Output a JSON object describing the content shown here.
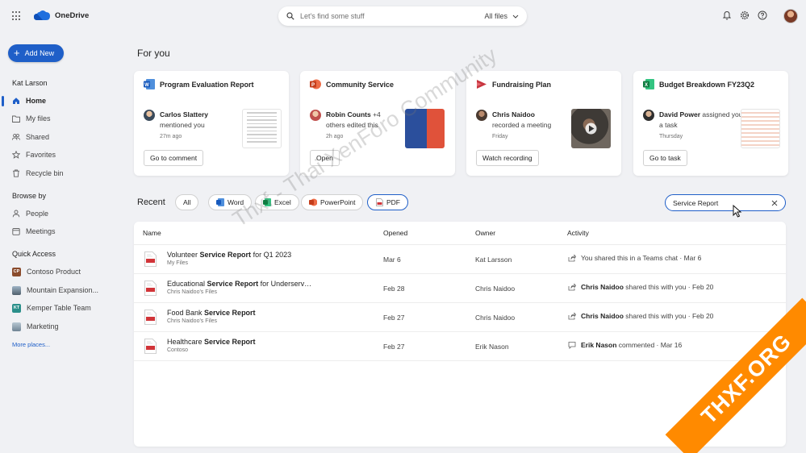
{
  "app": {
    "name": "OneDrive"
  },
  "search": {
    "placeholder": "Let's find some stuff",
    "scope": "All files"
  },
  "sidebar": {
    "add_new": "Add New",
    "user": "Kat Larson",
    "nav": [
      {
        "label": "Home",
        "icon": "home-icon"
      },
      {
        "label": "My files",
        "icon": "folder-icon"
      },
      {
        "label": "Shared",
        "icon": "people-icon"
      },
      {
        "label": "Favorites",
        "icon": "star-icon"
      },
      {
        "label": "Recycle bin",
        "icon": "trash-icon"
      }
    ],
    "browse_by": "Browse by",
    "browse": [
      {
        "label": "People",
        "icon": "person-icon"
      },
      {
        "label": "Meetings",
        "icon": "calendar-icon"
      }
    ],
    "quick_access": "Quick Access",
    "quick": [
      {
        "label": "Contoso Product",
        "badge": "CP",
        "color": "#8a4b2c"
      },
      {
        "label": "Mountain Expansion...",
        "badge": "",
        "color": "#6b7d8f"
      },
      {
        "label": "Kemper Table Team",
        "badge": "KT",
        "color": "#2a8f8a"
      },
      {
        "label": "Marketing",
        "badge": "",
        "color": "#8fa3b3"
      }
    ],
    "more_places": "More places..."
  },
  "for_you": {
    "heading": "For you",
    "cards": [
      {
        "title": "Program Evaluation Report",
        "app": "word",
        "person": "Carlos Slattery",
        "action": "mentioned you",
        "time": "27m ago",
        "button": "Go to comment"
      },
      {
        "title": "Community Service",
        "app": "powerpoint",
        "person": "Robin Counts",
        "extra": "+4",
        "action": "others edited this",
        "time": "2h ago",
        "button": "Open"
      },
      {
        "title": "Fundraising Plan",
        "app": "stream",
        "person": "Chris Naidoo",
        "action": "recorded a meeting",
        "time": "Friday",
        "button": "Watch recording"
      },
      {
        "title": "Budget Breakdown FY23Q2",
        "app": "excel",
        "person": "David Power",
        "action": "assigned you a task",
        "time": "Thursday",
        "button": "Go to task"
      }
    ]
  },
  "recent": {
    "heading": "Recent",
    "filters": [
      {
        "label": "All"
      },
      {
        "label": "Word"
      },
      {
        "label": "Excel"
      },
      {
        "label": "PowerPoint"
      },
      {
        "label": "PDF",
        "selected": true
      }
    ],
    "filter_value": "Service Report",
    "columns": {
      "name": "Name",
      "opened": "Opened",
      "owner": "Owner",
      "activity": "Activity"
    },
    "rows": [
      {
        "pre": "Volunteer ",
        "match": "Service Report",
        "post": " for Q1 2023",
        "location": "My Files",
        "opened": "Mar 6",
        "owner": "Kat Larsson",
        "actor": "",
        "activity": "You shared this in a Teams chat · Mar 6",
        "act_icon": "share-icon"
      },
      {
        "pre": "Educational ",
        "match": "Service Report",
        "post": " for Underserved...",
        "location": "Chris Naidoo's Files",
        "opened": "Feb 28",
        "owner": "Chris Naidoo",
        "actor": "Chris Naidoo",
        "activity": " shared this with you · Feb 20",
        "act_icon": "share-icon"
      },
      {
        "pre": "Food Bank ",
        "match": "Service Report",
        "post": "",
        "location": "Chris Naidoo's Files",
        "opened": "Feb 27",
        "owner": "Chris Naidoo",
        "actor": "Chris Naidoo",
        "activity": " shared this with you · Feb 20",
        "act_icon": "share-icon"
      },
      {
        "pre": "Healthcare ",
        "match": "Service Report",
        "post": "",
        "location": "Contoso",
        "opened": "Feb 27",
        "owner": "Erik Nason",
        "actor": "Erik Nason",
        "activity": " commented · Mar 16",
        "act_icon": "comment-icon"
      }
    ]
  },
  "overlay": {
    "watermark": "Thxf - Thai XenForo Community",
    "banner": "THXF.ORG"
  },
  "colors": {
    "accent": "#1f5fc8",
    "word": "#185abd",
    "excel": "#107c41",
    "powerpoint": "#c43e1c",
    "pdf": "#d13438",
    "banner": "#ff8a00"
  }
}
